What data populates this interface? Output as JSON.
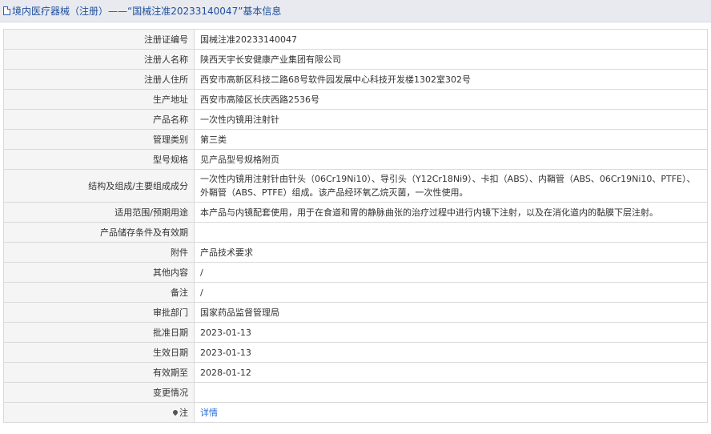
{
  "header": {
    "title": "境内医疗器械（注册）——“国械注准20233140047”基本信息"
  },
  "rows": [
    {
      "label": "注册证编号",
      "value": "国械注准20233140047"
    },
    {
      "label": "注册人名称",
      "value": "陕西天宇长安健康产业集团有限公司"
    },
    {
      "label": "注册人住所",
      "value": "西安市高新区科技二路68号软件园发展中心科技开发楼1302室302号"
    },
    {
      "label": "生产地址",
      "value": "西安市高陵区长庆西路2536号"
    },
    {
      "label": "产品名称",
      "value": "一次性内镜用注射针"
    },
    {
      "label": "管理类别",
      "value": "第三类"
    },
    {
      "label": "型号规格",
      "value": "见产品型号规格附页"
    },
    {
      "label": "结构及组成/主要组成成分",
      "value": "一次性内镜用注射针由针头（06Cr19Ni10）、导引头（Y12Cr18Ni9）、卡扣（ABS）、内鞘管（ABS、06Cr19Ni10、PTFE）、外鞘管（ABS、PTFE）组成。该产品经环氧乙烷灭菌，一次性使用。"
    },
    {
      "label": "适用范围/预期用途",
      "value": "本产品与内镜配套使用，用于在食道和胃的静脉曲张的治疗过程中进行内镜下注射，以及在消化道内的黏膜下层注射。"
    },
    {
      "label": "产品储存条件及有效期",
      "value": ""
    },
    {
      "label": "附件",
      "value": "产品技术要求"
    },
    {
      "label": "其他内容",
      "value": "/"
    },
    {
      "label": "备注",
      "value": "/"
    },
    {
      "label": "审批部门",
      "value": "国家药品监督管理局"
    },
    {
      "label": "批准日期",
      "value": "2023-01-13"
    },
    {
      "label": "生效日期",
      "value": "2023-01-13"
    },
    {
      "label": "有效期至",
      "value": "2028-01-12"
    },
    {
      "label": "变更情况",
      "value": ""
    }
  ],
  "note": {
    "label": "注",
    "link": "详情"
  }
}
